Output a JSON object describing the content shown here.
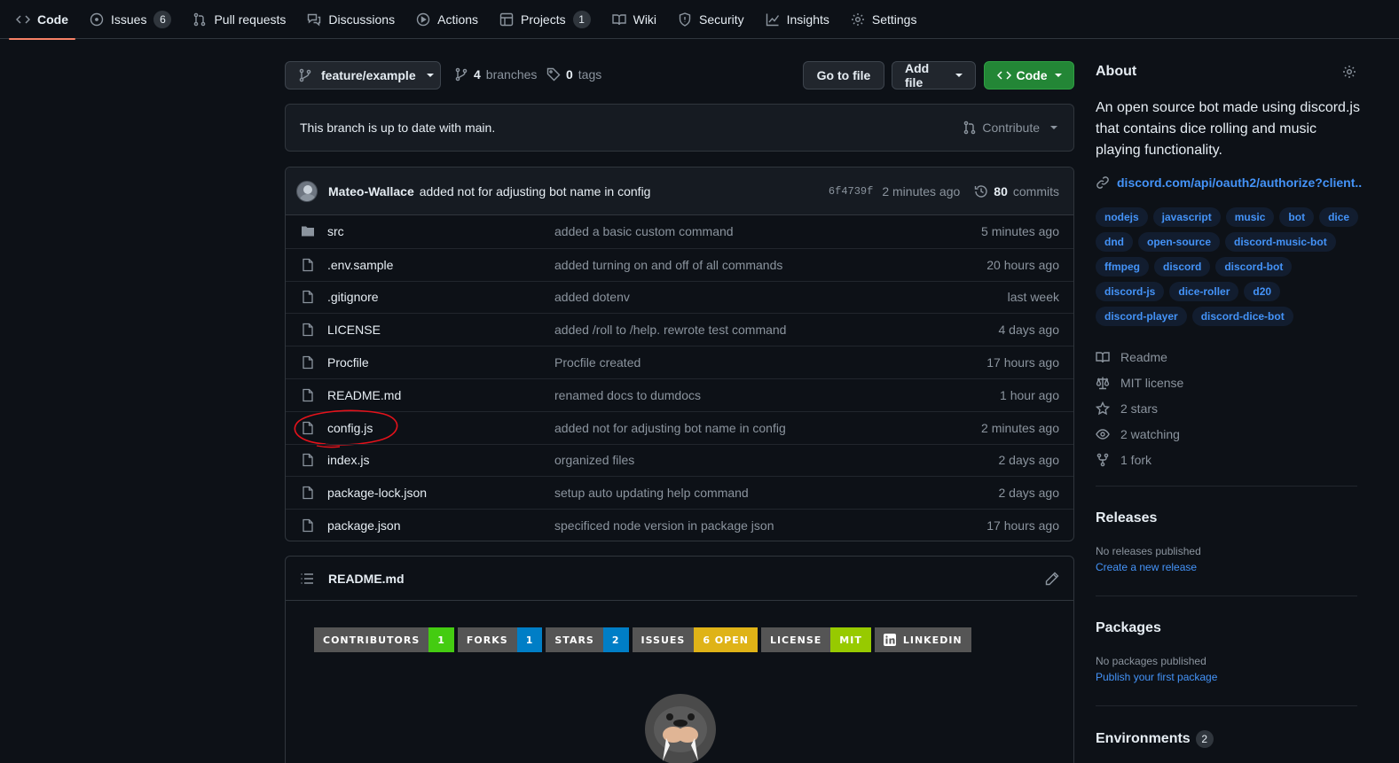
{
  "nav": {
    "tabs": [
      {
        "label": "Code",
        "icon": "code-icon"
      },
      {
        "label": "Issues",
        "icon": "issue-opened-icon",
        "count": "6"
      },
      {
        "label": "Pull requests",
        "icon": "git-pull-request-icon"
      },
      {
        "label": "Discussions",
        "icon": "comment-discussion-icon"
      },
      {
        "label": "Actions",
        "icon": "play-icon"
      },
      {
        "label": "Projects",
        "icon": "table-icon",
        "count": "1"
      },
      {
        "label": "Wiki",
        "icon": "book-icon"
      },
      {
        "label": "Security",
        "icon": "shield-icon"
      },
      {
        "label": "Insights",
        "icon": "graph-icon"
      },
      {
        "label": "Settings",
        "icon": "gear-icon"
      }
    ]
  },
  "branch_bar": {
    "branch": "feature/example",
    "branches_count": "4",
    "branches_label": "branches",
    "tags_count": "0",
    "tags_label": "tags",
    "go_to_file": "Go to file",
    "add_file": "Add file",
    "code": "Code"
  },
  "status": {
    "message": "This branch is up to date with main.",
    "contribute": "Contribute"
  },
  "latest_commit": {
    "author": "Mateo-Wallace",
    "message": "added not for adjusting bot name in config",
    "sha": "6f4739f",
    "time": "2 minutes ago",
    "commits_count": "80",
    "commits_label": "commits"
  },
  "files": [
    {
      "name": "src",
      "type": "dir",
      "message": "added a basic custom command",
      "age": "5 minutes ago"
    },
    {
      "name": ".env.sample",
      "type": "file",
      "message": "added turning on and off of all commands",
      "age": "20 hours ago"
    },
    {
      "name": ".gitignore",
      "type": "file",
      "message": "added dotenv",
      "age": "last week"
    },
    {
      "name": "LICENSE",
      "type": "file",
      "message": "added /roll to /help. rewrote test command",
      "age": "4 days ago"
    },
    {
      "name": "Procfile",
      "type": "file",
      "message": "Procfile created",
      "age": "17 hours ago"
    },
    {
      "name": "README.md",
      "type": "file",
      "message": "renamed docs to dumdocs",
      "age": "1 hour ago"
    },
    {
      "name": "config.js",
      "type": "file",
      "message": "added not for adjusting bot name in config",
      "age": "2 minutes ago",
      "annotated": true
    },
    {
      "name": "index.js",
      "type": "file",
      "message": "organized files",
      "age": "2 days ago"
    },
    {
      "name": "package-lock.json",
      "type": "file",
      "message": "setup auto updating help command",
      "age": "2 days ago"
    },
    {
      "name": "package.json",
      "type": "file",
      "message": "specificed node version in package json",
      "age": "17 hours ago"
    }
  ],
  "readme": {
    "title": "README.md",
    "badges": [
      {
        "label": "CONTRIBUTORS",
        "value": "1",
        "color": "#4c1"
      },
      {
        "label": "FORKS",
        "value": "1",
        "color": "#007ec6"
      },
      {
        "label": "STARS",
        "value": "2",
        "color": "#007ec6"
      },
      {
        "label": "ISSUES",
        "value": "6 OPEN",
        "color": "#dfb317"
      },
      {
        "label": "LICENSE",
        "value": "MIT",
        "color": "#97ca00"
      }
    ],
    "linkedin_badge": "LINKEDIN"
  },
  "about": {
    "title": "About",
    "description": "An open source bot made using discord.js that contains dice rolling and music playing functionality.",
    "link": "discord.com/api/oauth2/authorize?client...",
    "topics": [
      "nodejs",
      "javascript",
      "music",
      "bot",
      "dice",
      "dnd",
      "open-source",
      "discord-music-bot",
      "ffmpeg",
      "discord",
      "discord-bot",
      "discord-js",
      "dice-roller",
      "d20",
      "discord-player",
      "discord-dice-bot"
    ],
    "meta": [
      {
        "icon": "book-icon",
        "label": "Readme"
      },
      {
        "icon": "law-icon",
        "label": "MIT license"
      },
      {
        "icon": "star-icon",
        "label": "2 stars"
      },
      {
        "icon": "eye-icon",
        "label": "2 watching"
      },
      {
        "icon": "repo-forked-icon",
        "label": "1 fork"
      }
    ]
  },
  "releases": {
    "title": "Releases",
    "none": "No releases published",
    "link": "Create a new release"
  },
  "packages": {
    "title": "Packages",
    "none": "No packages published",
    "link": "Publish your first package"
  },
  "environments": {
    "title": "Environments",
    "count": "2"
  },
  "colors": {
    "accent": "#f78166",
    "primary_button": "#238636",
    "link": "#4493f8",
    "annotation": "#e5121b"
  }
}
